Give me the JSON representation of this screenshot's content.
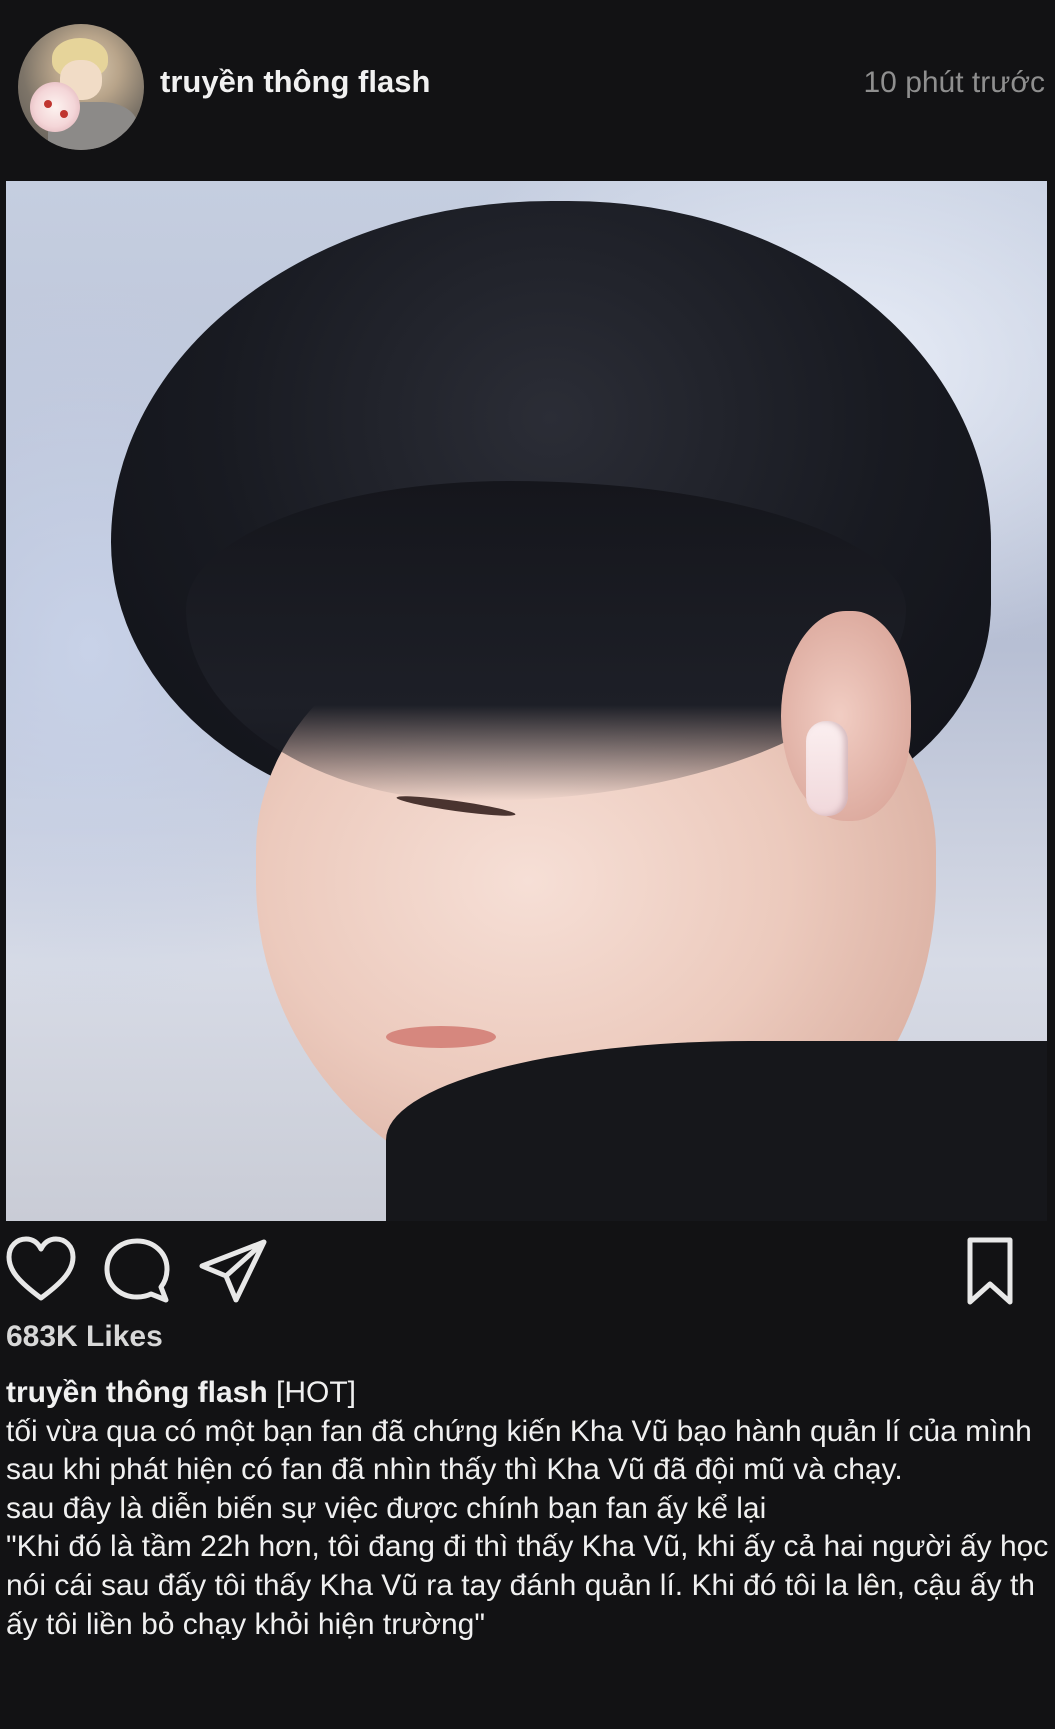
{
  "post": {
    "username": "truyền thông flash",
    "time_ago": "10 phút trước",
    "likes": "683K Likes",
    "caption_tag": "[HOT]",
    "caption_lines": [
      "tối vừa qua có một bạn fan đã chứng kiến Kha Vũ bạo hành quản lí của mình sau khi phát hiện có fan đã nhìn thấy thì Kha Vũ đã đội mũ và chạy.",
      "sau đây là diễn biến sự việc được chính bạn fan ấy kể lại",
      "\"Khi đó là tầm 22h hơn, tôi đang đi thì thấy Kha Vũ, khi ấy cả hai người ấy học nói cái sau đấy tôi thấy Kha Vũ ra tay đánh quản lí. Khi đó tôi la lên, cậu ấy thấy tôi liền bỏ chạy khỏi hiện trường\""
    ]
  },
  "icons": {
    "like": "heart-icon",
    "comment": "comment-icon",
    "share": "paper-plane-icon",
    "save": "bookmark-icon"
  },
  "colors": {
    "background": "#121214",
    "text": "#f2f2f2",
    "muted": "#8f8f8f"
  }
}
